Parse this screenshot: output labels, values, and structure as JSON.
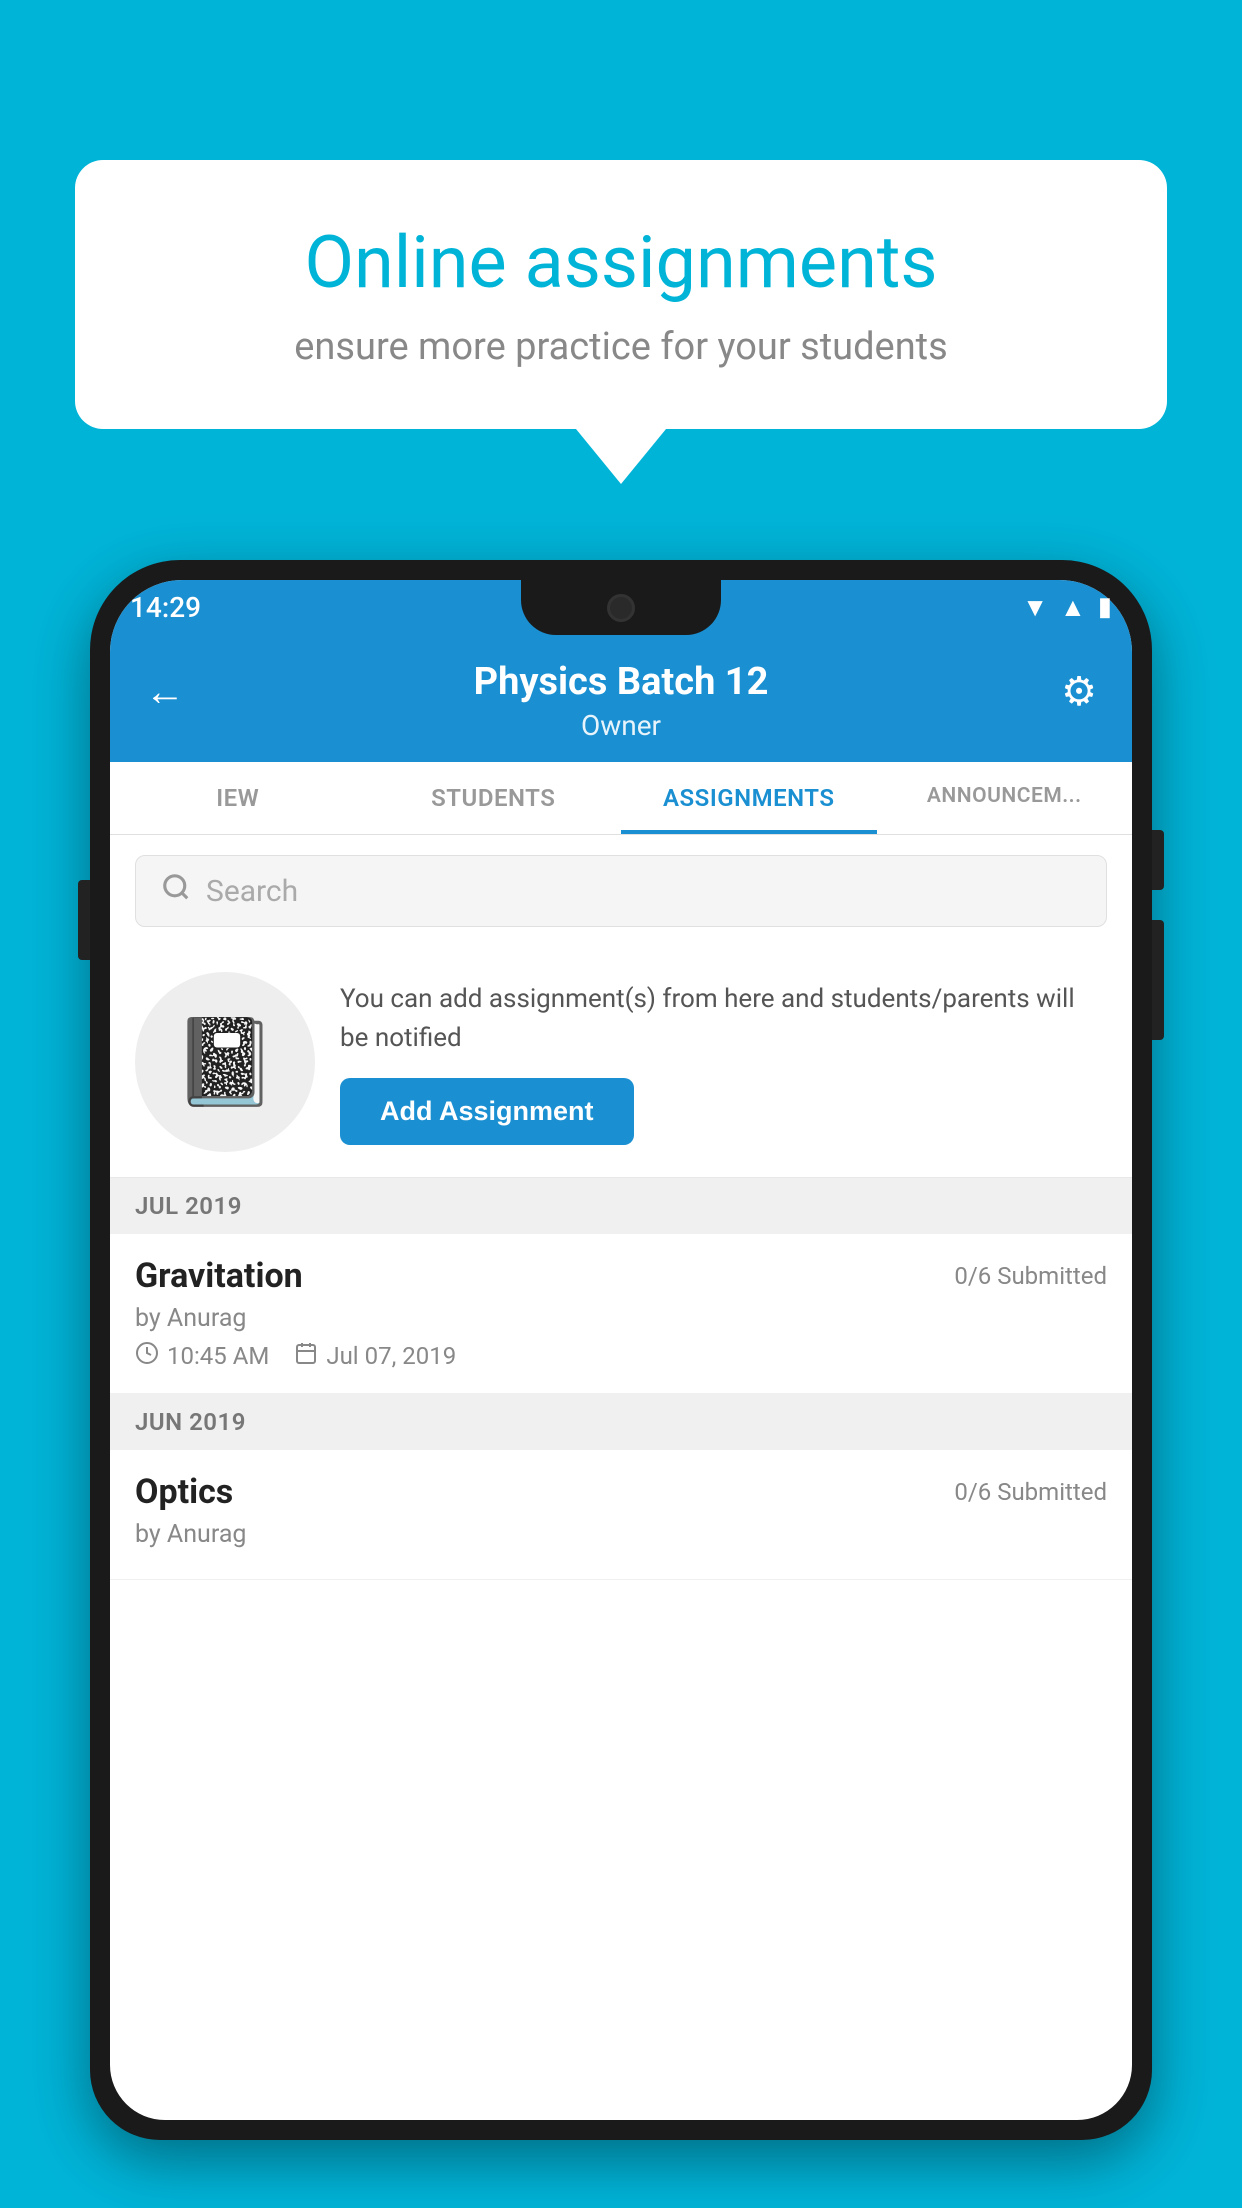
{
  "background_color": "#00B4D8",
  "speech_bubble": {
    "title": "Online assignments",
    "subtitle": "ensure more practice for your students"
  },
  "phone": {
    "status_bar": {
      "time": "14:29",
      "icons": [
        "wifi",
        "signal",
        "battery"
      ]
    },
    "header": {
      "title": "Physics Batch 12",
      "subtitle": "Owner",
      "back_label": "←",
      "gear_label": "⚙"
    },
    "tabs": [
      {
        "label": "IEW",
        "active": false
      },
      {
        "label": "STUDENTS",
        "active": false
      },
      {
        "label": "ASSIGNMENTS",
        "active": true
      },
      {
        "label": "ANNOUNCEM...",
        "active": false
      }
    ],
    "search": {
      "placeholder": "Search"
    },
    "promo": {
      "text": "You can add assignment(s) from here and students/parents will be notified",
      "button_label": "Add Assignment"
    },
    "sections": [
      {
        "header": "JUL 2019",
        "assignments": [
          {
            "name": "Gravitation",
            "submitted": "0/6 Submitted",
            "author": "by Anurag",
            "time": "10:45 AM",
            "date": "Jul 07, 2019"
          }
        ]
      },
      {
        "header": "JUN 2019",
        "assignments": [
          {
            "name": "Optics",
            "submitted": "0/6 Submitted",
            "author": "by Anurag",
            "time": "",
            "date": ""
          }
        ]
      }
    ]
  }
}
